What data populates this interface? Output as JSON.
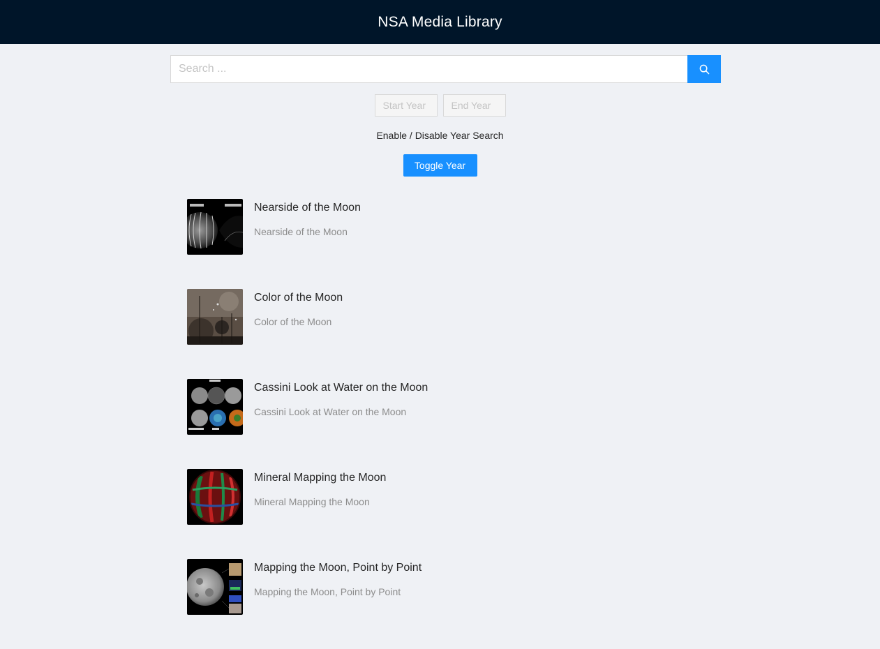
{
  "header": {
    "title": "NSA Media Library"
  },
  "search": {
    "placeholder": "Search ...",
    "value": "",
    "button_icon": "search-icon"
  },
  "year_filter": {
    "start_placeholder": "Start Year",
    "end_placeholder": "End Year",
    "label": "Enable / Disable Year Search",
    "toggle_label": "Toggle Year"
  },
  "results": [
    {
      "title": "Nearside of the Moon",
      "description": "Nearside of the Moon"
    },
    {
      "title": "Color of the Moon",
      "description": "Color of the Moon"
    },
    {
      "title": "Cassini Look at Water on the Moon",
      "description": "Cassini Look at Water on the Moon"
    },
    {
      "title": "Mineral Mapping the Moon",
      "description": "Mineral Mapping the Moon"
    },
    {
      "title": "Mapping the Moon, Point by Point",
      "description": "Mapping the Moon, Point by Point"
    }
  ],
  "colors": {
    "header_bg": "#001529",
    "accent": "#1890ff",
    "page_bg": "#eff1f5"
  }
}
